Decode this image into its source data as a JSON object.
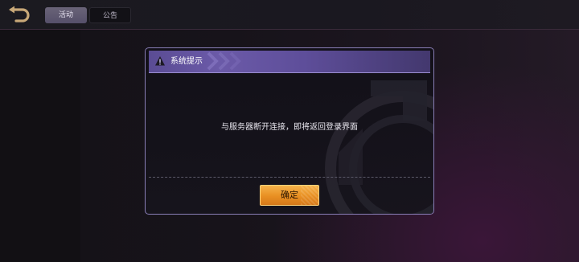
{
  "topbar": {
    "back_icon": "back-arrow-icon",
    "tabs": [
      {
        "label": "活动",
        "active": true
      },
      {
        "label": "公告",
        "active": false
      }
    ]
  },
  "dialog": {
    "title": "系统提示",
    "title_icon": "warning-icon",
    "message": "与服务器断开连接，即将返回登录界面",
    "confirm_label": "确定"
  },
  "colors": {
    "header_purple": "#6b5aa8",
    "dialog_border": "#8a7fb8",
    "confirm_orange": "#e88f22",
    "back_arrow_gold": "#c8a878"
  }
}
